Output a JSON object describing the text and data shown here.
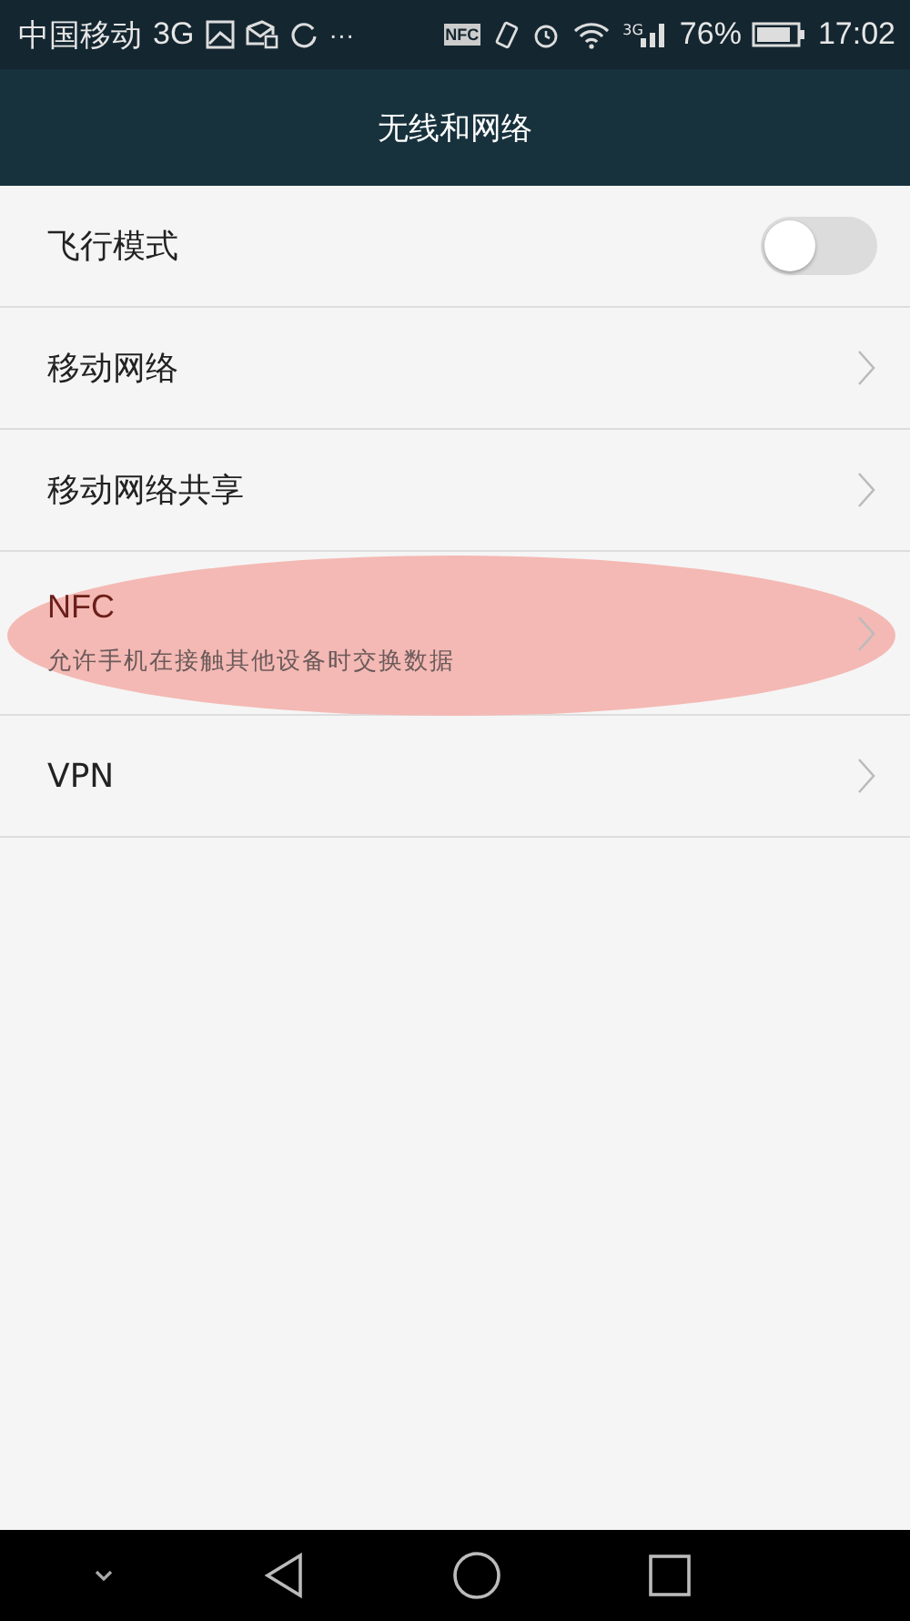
{
  "status_bar": {
    "carrier": "中国移动",
    "network": "3G",
    "more": "···",
    "nfc": "NFC",
    "signal_network": "3G",
    "battery": "76%",
    "time": "17:02"
  },
  "title": "无线和网络",
  "items": [
    {
      "kind": "toggle",
      "label": "飞行模式",
      "on": false,
      "highlighted": false
    },
    {
      "kind": "link",
      "label": "移动网络",
      "highlighted": false
    },
    {
      "kind": "link",
      "label": "移动网络共享",
      "highlighted": false
    },
    {
      "kind": "link",
      "label": "NFC",
      "subtitle": "允许手机在接触其他设备时交换数据",
      "highlighted": true
    },
    {
      "kind": "link",
      "label": "VPN",
      "highlighted": false
    }
  ]
}
